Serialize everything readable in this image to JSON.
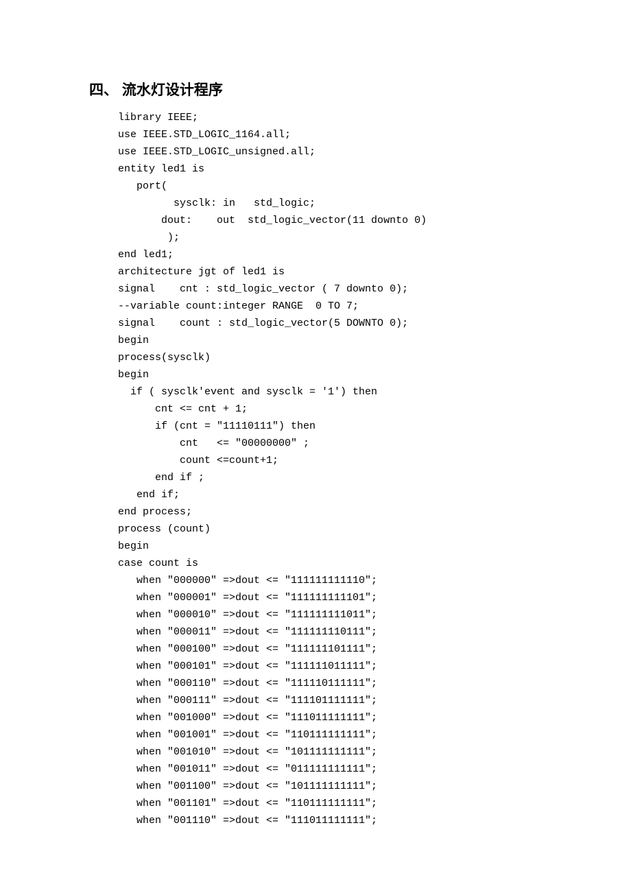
{
  "heading": "四、 流水灯设计程序",
  "code_lines": [
    "library IEEE;",
    "use IEEE.STD_LOGIC_1164.all;",
    "use IEEE.STD_LOGIC_unsigned.all;",
    "entity led1 is",
    "   port(",
    "         sysclk: in   std_logic;",
    "       dout:    out  std_logic_vector(11 downto 0)",
    "        );",
    "end led1;",
    "architecture jgt of led1 is",
    "signal    cnt : std_logic_vector ( 7 downto 0);",
    "--variable count:integer RANGE  0 TO 7;",
    "signal    count : std_logic_vector(5 DOWNTO 0);",
    "begin",
    "process(sysclk)",
    "begin",
    "  if ( sysclk'event and sysclk = '1') then",
    "      cnt <= cnt + 1;",
    "      if (cnt = \"11110111\") then",
    "          cnt   <= \"00000000\" ;",
    "          count <=count+1;",
    "      end if ;",
    "   end if;",
    "end process;",
    "process (count)",
    "begin",
    "case count is",
    "   when \"000000\" =>dout <= \"111111111110\";",
    "   when \"000001\" =>dout <= \"111111111101\";",
    "   when \"000010\" =>dout <= \"111111111011\";",
    "   when \"000011\" =>dout <= \"111111110111\";",
    "   when \"000100\" =>dout <= \"111111101111\";",
    "   when \"000101\" =>dout <= \"111111011111\";",
    "   when \"000110\" =>dout <= \"111110111111\";",
    "   when \"000111\" =>dout <= \"111101111111\";",
    "   when \"001000\" =>dout <= \"111011111111\";",
    "   when \"001001\" =>dout <= \"110111111111\";",
    "   when \"001010\" =>dout <= \"101111111111\";",
    "   when \"001011\" =>dout <= \"011111111111\";",
    "   when \"001100\" =>dout <= \"101111111111\";",
    "   when \"001101\" =>dout <= \"110111111111\";",
    "   when \"001110\" =>dout <= \"111011111111\";"
  ]
}
